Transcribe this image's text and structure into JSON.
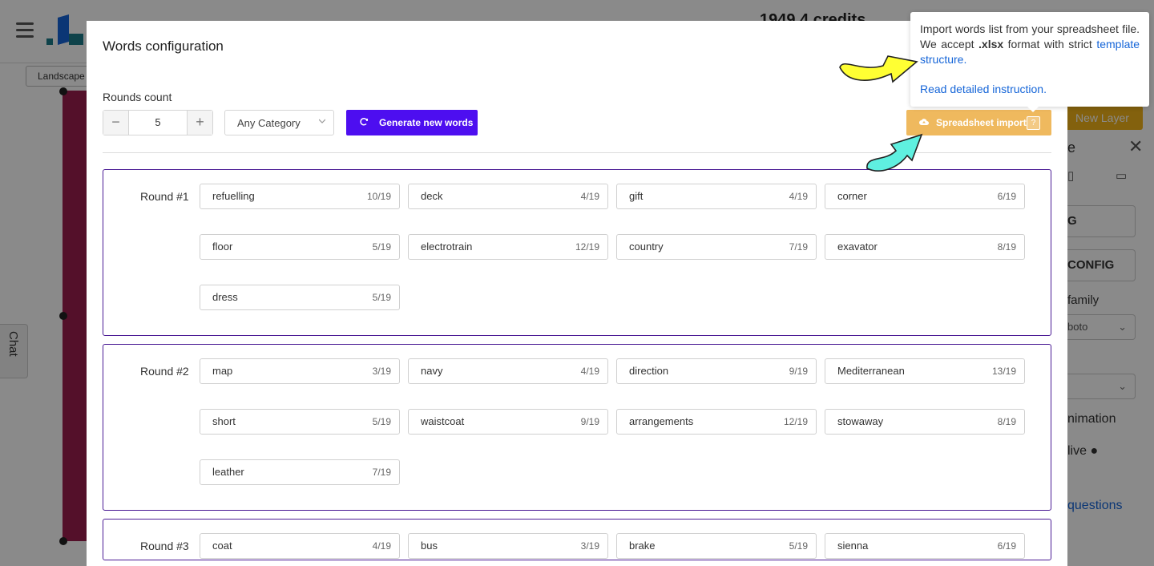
{
  "background": {
    "credits": "1949.4 credits",
    "landscape_label": "Landscape",
    "chat_label": "Chat",
    "right_panel": {
      "new_layer": "New Layer",
      "title_fragment": "e",
      "button_1": "G",
      "button_2": "CONFIG",
      "font_family_label": "family",
      "font_value": "boto",
      "animation_label": "nimation",
      "live_label": "live",
      "questions_link": "questions"
    }
  },
  "modal": {
    "title": "Words configuration",
    "rounds_label": "Rounds count",
    "rounds_value": "5",
    "category": "Any Category",
    "generate_label": "Generate new words",
    "import_label": "Spreadsheet import",
    "import_help": "?",
    "rounds": [
      {
        "label": "Round #1",
        "words": [
          {
            "word": "refuelling",
            "count": "10/19"
          },
          {
            "word": "deck",
            "count": "4/19"
          },
          {
            "word": "gift",
            "count": "4/19"
          },
          {
            "word": "corner",
            "count": "6/19"
          },
          {
            "word": "floor",
            "count": "5/19"
          },
          {
            "word": "electrotrain",
            "count": "12/19"
          },
          {
            "word": "country",
            "count": "7/19"
          },
          {
            "word": "exavator",
            "count": "8/19"
          },
          {
            "word": "dress",
            "count": "5/19"
          }
        ]
      },
      {
        "label": "Round #2",
        "words": [
          {
            "word": "map",
            "count": "3/19"
          },
          {
            "word": "navy",
            "count": "4/19"
          },
          {
            "word": "direction",
            "count": "9/19"
          },
          {
            "word": "Mediterranean",
            "count": "13/19"
          },
          {
            "word": "short",
            "count": "5/19"
          },
          {
            "word": "waistcoat",
            "count": "9/19"
          },
          {
            "word": "arrangements",
            "count": "12/19"
          },
          {
            "word": "stowaway",
            "count": "8/19"
          },
          {
            "word": "leather",
            "count": "7/19"
          }
        ]
      },
      {
        "label": "Round #3",
        "words": [
          {
            "word": "coat",
            "count": "4/19"
          },
          {
            "word": "bus",
            "count": "3/19"
          },
          {
            "word": "brake",
            "count": "5/19"
          },
          {
            "word": "sienna",
            "count": "6/19"
          }
        ]
      }
    ]
  },
  "tooltip": {
    "text_1": "Import words list from your spreadsheet file. We accept",
    "text_bold": ".xlsx",
    "text_2": "format with strict",
    "link_template": "template structure.",
    "link_instruction": "Read detailed instruction."
  },
  "colors": {
    "generate_button": "#4d0ef0",
    "import_button": "#efb95e",
    "round_border": "#4a1a94",
    "link": "#1565d8",
    "arrow_yellow": "#ffff33",
    "arrow_cyan": "#5ff0e0"
  }
}
